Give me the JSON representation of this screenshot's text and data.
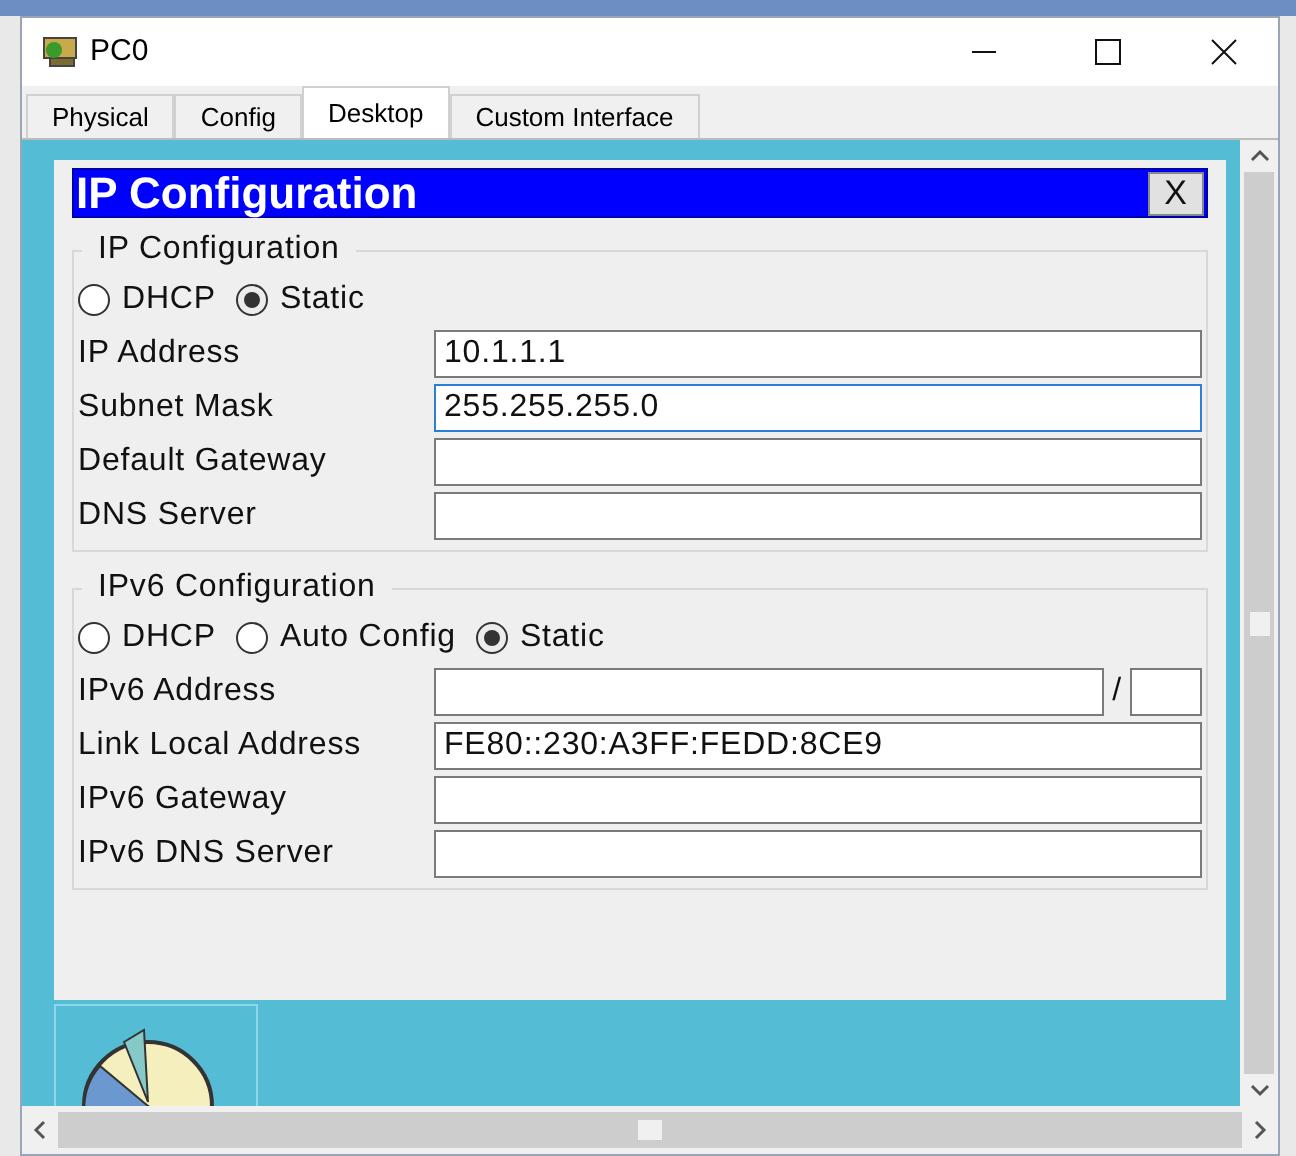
{
  "window": {
    "title": "PC0"
  },
  "tabs": [
    {
      "label": "Physical",
      "selected": false
    },
    {
      "label": "Config",
      "selected": false
    },
    {
      "label": "Desktop",
      "selected": true
    },
    {
      "label": "Custom Interface",
      "selected": false
    }
  ],
  "dialog": {
    "title": "IP Configuration",
    "close": "X",
    "sections": [
      {
        "legend": "IP Configuration",
        "modes": [
          {
            "label": "DHCP",
            "selected": false
          },
          {
            "label": "Static",
            "selected": true
          }
        ],
        "fields": [
          {
            "kind": "text",
            "label": "IP Address",
            "value": "10.1.1.1",
            "focused": false
          },
          {
            "kind": "text",
            "label": "Subnet Mask",
            "value": "255.255.255.0",
            "focused": true
          },
          {
            "kind": "text",
            "label": "Default Gateway",
            "focused": false
          },
          {
            "kind": "text",
            "label": "DNS Server",
            "focused": false
          }
        ]
      },
      {
        "legend": "IPv6 Configuration",
        "modes": [
          {
            "label": "DHCP",
            "selected": false
          },
          {
            "label": "Auto Config",
            "selected": false
          },
          {
            "label": "Static",
            "selected": true
          }
        ],
        "fields": [
          {
            "kind": "prefix",
            "label": "IPv6 Address",
            "separator": "/",
            "focused": false
          },
          {
            "kind": "text",
            "label": "Link Local Address",
            "value": "FE80::230:A3FF:FEDD:8CE9",
            "focused": false
          },
          {
            "kind": "text",
            "label": "IPv6 Gateway",
            "focused": false
          },
          {
            "kind": "text",
            "label": "IPv6 DNS Server",
            "focused": false
          }
        ]
      }
    ]
  }
}
